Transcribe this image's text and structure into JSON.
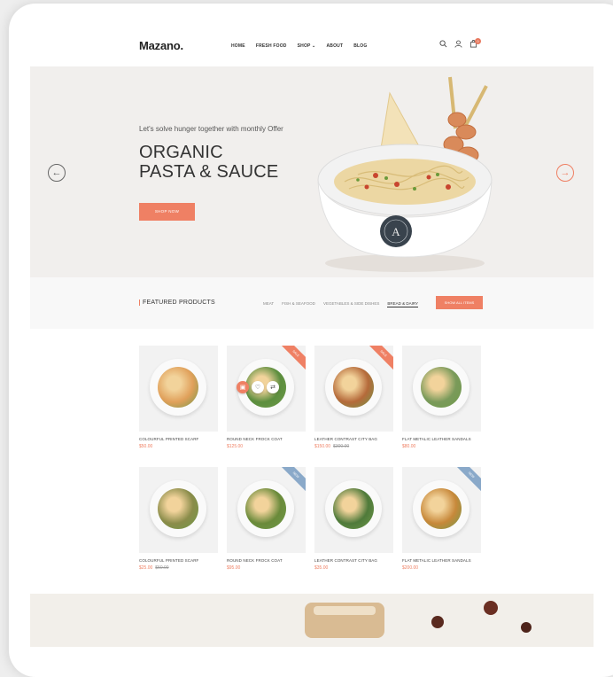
{
  "header": {
    "logo": "Mazano.",
    "nav": [
      "HOME",
      "FRESH FOOD",
      "SHOP ⌄",
      "ABOUT",
      "BLOG"
    ],
    "icons": [
      "search-icon",
      "user-icon",
      "cart-icon"
    ],
    "cart_count": "0"
  },
  "hero": {
    "tagline": "Let's solve hunger together with monthly Offer",
    "title_line1": "ORGANIC",
    "title_line2": "PASTA & SAUCE",
    "button": "SHOP NOW",
    "prev_arrow": "←",
    "next_arrow": "→",
    "bowl_logo": "A"
  },
  "featured": {
    "title": "FEATURED PRODUCTS",
    "categories": [
      "MEAT",
      "FISH & SEAFOOD",
      "VEGETABLES & SIDE DISHES",
      "BREAD & DAIRY"
    ],
    "active_category": "BREAD & DAIRY",
    "all_button": "SHOW ALL ITEMS"
  },
  "products": [
    {
      "name": "COLOURFUL PRINTED SCARF",
      "price": "$50.00",
      "old_price": "",
      "badge": "",
      "color": "#e0a05a"
    },
    {
      "name": "ROUND NECK FROCK COAT",
      "price": "$125.00",
      "old_price": "",
      "badge": "SALE",
      "color": "#5c8e3e"
    },
    {
      "name": "LEATHER CONTRAST CITY BAG",
      "price": "$150.00",
      "old_price": "$300.00",
      "badge": "SALE",
      "color": "#b56a3a"
    },
    {
      "name": "FLAT METALIC LEATHER SANDALS",
      "price": "$80.00",
      "old_price": "",
      "badge": "",
      "color": "#7a9a5a"
    },
    {
      "name": "COLOURFUL PRINTED SCARF",
      "price": "$25.00",
      "old_price": "$50.00",
      "badge": "",
      "color": "#8a8c4a"
    },
    {
      "name": "ROUND NECK FROCK COAT",
      "price": "$95.00",
      "old_price": "",
      "badge": "NEW",
      "color": "#6a8a3a"
    },
    {
      "name": "LEATHER CONTRAST CITY BAG",
      "price": "$35.00",
      "old_price": "",
      "badge": "",
      "color": "#4f7a3a"
    },
    {
      "name": "FLAT METALIC LEATHER SANDALS",
      "price": "$200.00",
      "old_price": "",
      "badge": "NEW",
      "color": "#c7883a"
    }
  ],
  "colors": {
    "accent": "#ef8064",
    "new_badge": "#8aa9c9"
  }
}
